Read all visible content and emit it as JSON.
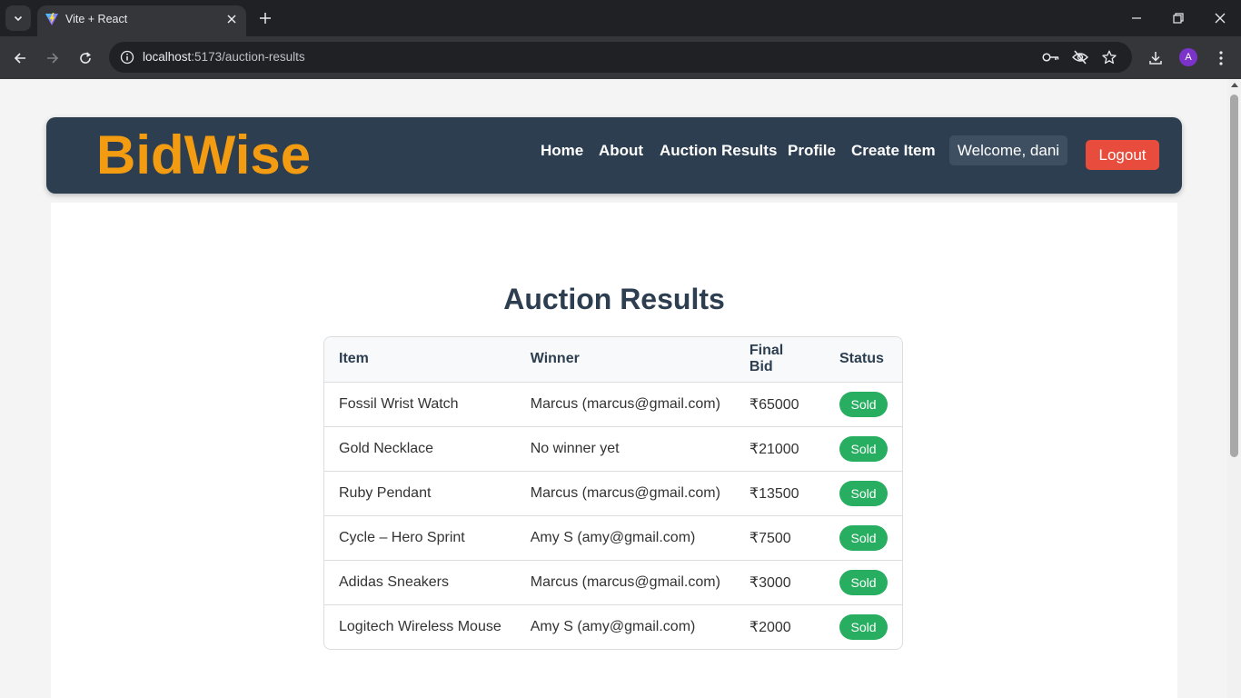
{
  "browser": {
    "tab_title": "Vite + React",
    "url_host": "localhost",
    "url_path": ":5173/auction-results",
    "profile_initial": "A",
    "icons": {
      "tab_search": "chevron-down-icon",
      "favicon": "vite-logo-icon",
      "close_tab": "close-icon",
      "new_tab": "plus-icon",
      "back": "arrow-left-icon",
      "forward": "arrow-right-icon",
      "reload": "reload-icon",
      "site_info": "info-icon",
      "password": "key-icon",
      "eye": "eye-off-icon",
      "bookmark": "star-icon",
      "downloads": "download-icon",
      "menu": "more-vert-icon"
    }
  },
  "app": {
    "logo": "BidWise",
    "nav": {
      "home": "Home",
      "about": "About",
      "auction_results": "Auction Results",
      "profile": "Profile",
      "create_item": "Create Item"
    },
    "welcome": "Welcome, dani",
    "logout": "Logout"
  },
  "page": {
    "title": "Auction Results",
    "columns": [
      "Item",
      "Winner",
      "Final Bid",
      "Status"
    ],
    "rows": [
      {
        "item": "Fossil Wrist Watch",
        "winner": "Marcus (marcus@gmail.com)",
        "final_bid": "₹65000",
        "status": "Sold"
      },
      {
        "item": "Gold Necklace",
        "winner": "No winner yet",
        "final_bid": "₹21000",
        "status": "Sold"
      },
      {
        "item": "Ruby Pendant",
        "winner": "Marcus (marcus@gmail.com)",
        "final_bid": "₹13500",
        "status": "Sold"
      },
      {
        "item": "Cycle – Hero Sprint",
        "winner": "Amy S (amy@gmail.com)",
        "final_bid": "₹7500",
        "status": "Sold"
      },
      {
        "item": "Adidas Sneakers",
        "winner": "Marcus (marcus@gmail.com)",
        "final_bid": "₹3000",
        "status": "Sold"
      },
      {
        "item": "Logitech Wireless Mouse",
        "winner": "Amy S (amy@gmail.com)",
        "final_bid": "₹2000",
        "status": "Sold"
      }
    ]
  },
  "colors": {
    "header_bg": "#2c3e50",
    "logo": "#f39c12",
    "logout": "#e74c3c",
    "sold_badge": "#27ae60",
    "title": "#2c3e50"
  }
}
